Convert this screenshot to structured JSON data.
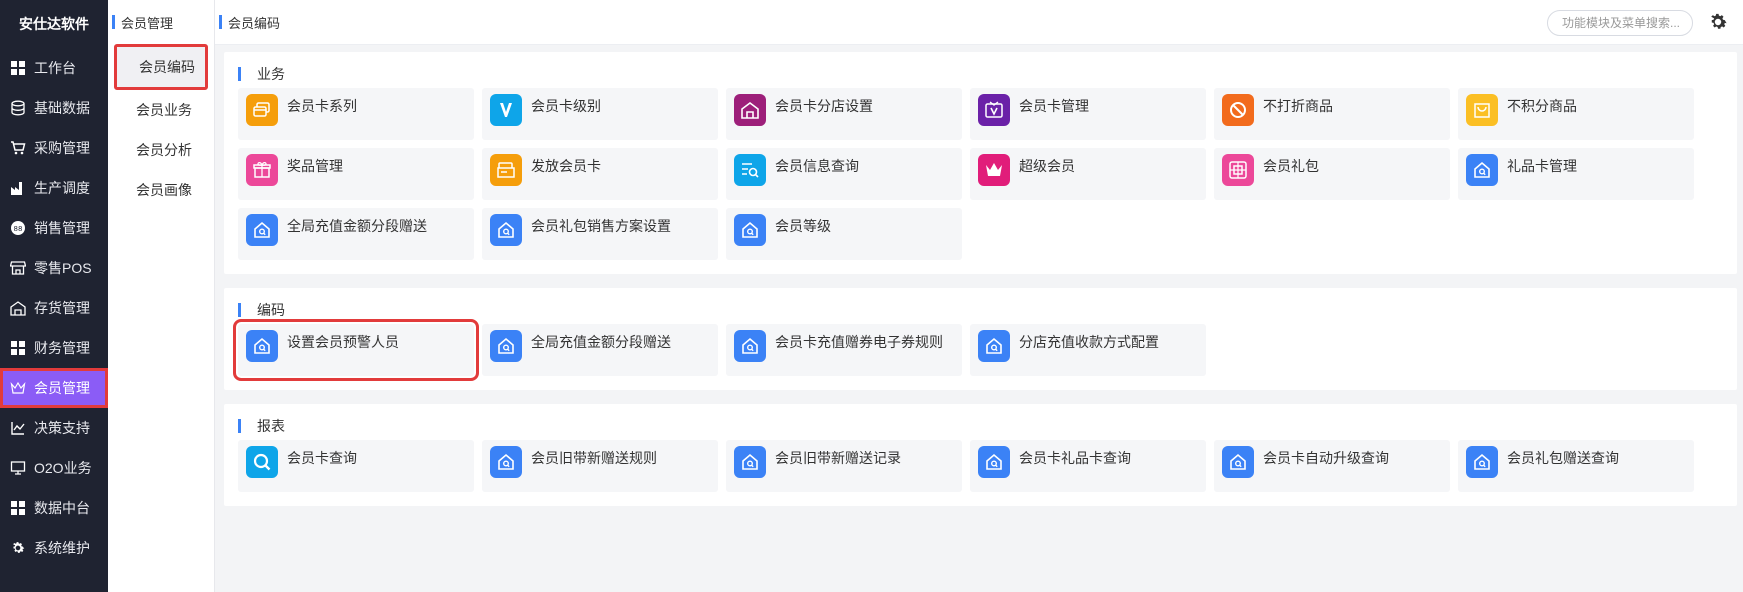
{
  "sidebar": {
    "brand": "安仕达软件",
    "items": [
      {
        "label": "工作台",
        "icon": "grid-icon"
      },
      {
        "label": "基础数据",
        "icon": "database-icon"
      },
      {
        "label": "采购管理",
        "icon": "cart-icon"
      },
      {
        "label": "生产调度",
        "icon": "factory-icon"
      },
      {
        "label": "销售管理",
        "icon": "sales-icon"
      },
      {
        "label": "零售POS",
        "icon": "store-icon"
      },
      {
        "label": "存货管理",
        "icon": "warehouse-icon"
      },
      {
        "label": "财务管理",
        "icon": "grid-icon"
      },
      {
        "label": "会员管理",
        "icon": "crown-icon",
        "active": true
      },
      {
        "label": "决策支持",
        "icon": "decision-icon"
      },
      {
        "label": "O2O业务",
        "icon": "monitor-icon"
      },
      {
        "label": "数据中台",
        "icon": "grid-icon"
      },
      {
        "label": "系统维护",
        "icon": "gear-icon"
      }
    ]
  },
  "submenu": {
    "title": "会员管理",
    "items": [
      {
        "label": "会员编码",
        "active": true
      },
      {
        "label": "会员业务"
      },
      {
        "label": "会员分析"
      },
      {
        "label": "会员画像"
      }
    ]
  },
  "topbar": {
    "title": "会员编码",
    "search_placeholder": "功能模块及菜单搜索..."
  },
  "sections": [
    {
      "title": "业务",
      "cards": [
        {
          "label": "会员卡系列",
          "icon": "card-series-icon",
          "color": "#f59e0b"
        },
        {
          "label": "会员卡级别",
          "icon": "v-level-icon",
          "color": "#0ea5e9"
        },
        {
          "label": "会员卡分店设置",
          "icon": "store-house-icon",
          "color": "#9d1f7a"
        },
        {
          "label": "会员卡管理",
          "icon": "vip-card-icon",
          "color": "#6b21a8"
        },
        {
          "label": "不打折商品",
          "icon": "no-discount-icon",
          "color": "#f26b1d"
        },
        {
          "label": "不积分商品",
          "icon": "no-points-icon",
          "color": "#fbbf24"
        },
        {
          "label": "奖品管理",
          "icon": "gift-icon",
          "color": "#ec4899"
        },
        {
          "label": "发放会员卡",
          "icon": "issue-card-icon",
          "color": "#f59e0b"
        },
        {
          "label": "会员信息查询",
          "icon": "info-search-icon",
          "color": "#0ea5e9"
        },
        {
          "label": "超级会员",
          "icon": "super-crown-icon",
          "color": "#e11d7a"
        },
        {
          "label": "会员礼包",
          "icon": "gift-package-icon",
          "color": "#ec4899"
        },
        {
          "label": "礼品卡管理",
          "icon": "home-search-icon",
          "color": "#3b82f6"
        },
        {
          "label": "全局充值金额分段赠送",
          "icon": "home-search-icon",
          "color": "#3b82f6"
        },
        {
          "label": "会员礼包销售方案设置",
          "icon": "home-search-icon",
          "color": "#3b82f6"
        },
        {
          "label": "会员等级",
          "icon": "home-search-icon",
          "color": "#3b82f6"
        }
      ]
    },
    {
      "title": "编码",
      "cards": [
        {
          "label": "设置会员预警人员",
          "icon": "home-search-icon",
          "color": "#3b82f6",
          "highlight": true
        },
        {
          "label": "全局充值金额分段赠送",
          "icon": "home-search-icon",
          "color": "#3b82f6"
        },
        {
          "label": "会员卡充值赠券电子券规则",
          "icon": "home-search-icon",
          "color": "#3b82f6"
        },
        {
          "label": "分店充值收款方式配置",
          "icon": "home-search-icon",
          "color": "#3b82f6"
        }
      ]
    },
    {
      "title": "报表",
      "cards": [
        {
          "label": "会员卡查询",
          "icon": "magnifier-icon",
          "color": "#0ea5e9"
        },
        {
          "label": "会员旧带新赠送规则",
          "icon": "home-search-icon",
          "color": "#3b82f6"
        },
        {
          "label": "会员旧带新赠送记录",
          "icon": "home-search-icon",
          "color": "#3b82f6"
        },
        {
          "label": "会员卡礼品卡查询",
          "icon": "home-search-icon",
          "color": "#3b82f6"
        },
        {
          "label": "会员卡自动升级查询",
          "icon": "home-search-icon",
          "color": "#3b82f6"
        },
        {
          "label": "会员礼包赠送查询",
          "icon": "home-search-icon",
          "color": "#3b82f6"
        }
      ]
    }
  ]
}
